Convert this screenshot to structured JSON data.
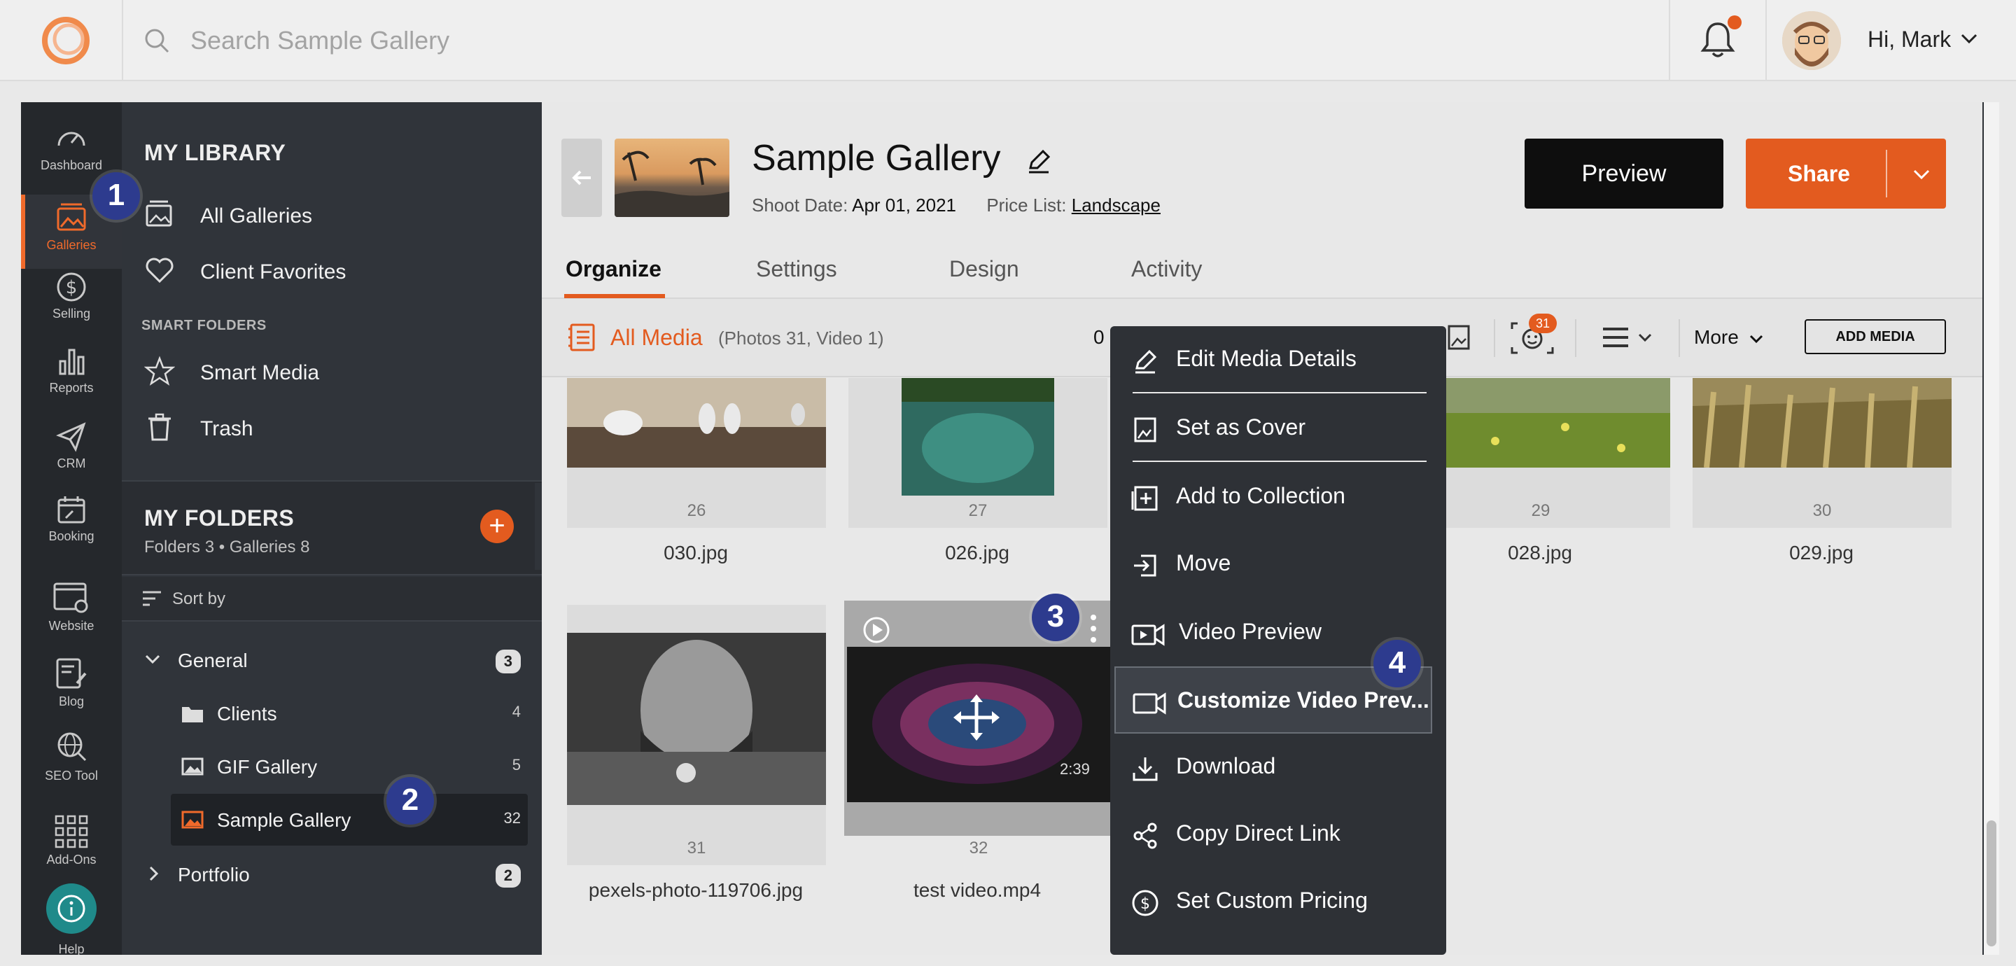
{
  "topbar": {
    "search_placeholder": "Search Sample Gallery",
    "greeting": "Hi, Mark"
  },
  "rail": {
    "items": [
      {
        "label": "Dashboard",
        "icon": "speedometer-icon"
      },
      {
        "label": "Galleries",
        "icon": "galleries-icon",
        "active": true
      },
      {
        "label": "Selling",
        "icon": "dollar-icon"
      },
      {
        "label": "Reports",
        "icon": "bar-chart-icon"
      },
      {
        "label": "CRM",
        "icon": "paper-plane-icon"
      },
      {
        "label": "Booking",
        "icon": "calendar-icon"
      },
      {
        "label": "Website",
        "icon": "website-icon"
      },
      {
        "label": "Blog",
        "icon": "blog-icon"
      },
      {
        "label": "SEO Tool",
        "icon": "globe-icon"
      },
      {
        "label": "Add-Ons",
        "icon": "grid-icon"
      },
      {
        "label": "Help",
        "icon": "help-icon"
      }
    ]
  },
  "library": {
    "title": "MY LIBRARY",
    "items": [
      {
        "label": "All Galleries",
        "icon": "galleries-icon"
      },
      {
        "label": "Client Favorites",
        "icon": "heart-icon"
      }
    ],
    "smart_folders_label": "SMART FOLDERS",
    "smart_items": [
      {
        "label": "Smart Media",
        "icon": "star-icon"
      },
      {
        "label": "Trash",
        "icon": "trash-icon"
      }
    ],
    "folders_title": "MY FOLDERS",
    "folders_subtitle": "Folders 3 • Galleries 8",
    "sort_label": "Sort by",
    "tree": [
      {
        "label": "General",
        "count": "3"
      },
      {
        "label": "Clients",
        "count": "4"
      },
      {
        "label": "GIF Gallery",
        "count": "5"
      },
      {
        "label": "Sample Gallery",
        "count": "32"
      },
      {
        "label": "Portfolio",
        "count": "2"
      }
    ]
  },
  "gallery": {
    "title": "Sample Gallery",
    "shoot_date_label": "Shoot Date:",
    "shoot_date": "Apr 01, 2021",
    "price_list_label": "Price List:",
    "price_list": "Landscape",
    "preview_label": "Preview",
    "share_label": "Share"
  },
  "tabs": [
    "Organize",
    "Settings",
    "Design",
    "Activity"
  ],
  "toolbar": {
    "all_media": "All Media",
    "media_count": "(Photos 31, Video 1)",
    "selected_prefix": "0",
    "face_count": "31",
    "more_label": "More",
    "add_media": "ADD MEDIA"
  },
  "media": [
    {
      "num": "26",
      "name": "030.jpg"
    },
    {
      "num": "27",
      "name": "026.jpg"
    },
    {
      "num": "29",
      "name": "028.jpg"
    },
    {
      "num": "30",
      "name": "029.jpg"
    },
    {
      "num": "31",
      "name": "pexels-photo-119706.jpg"
    },
    {
      "num": "32",
      "name": "test video.mp4",
      "duration": "2:39"
    }
  ],
  "context_menu": [
    {
      "label": "Edit Media Details",
      "icon": "pencil-icon"
    },
    {
      "label": "Set as Cover",
      "icon": "image-frame-icon"
    },
    {
      "label": "Add to Collection",
      "icon": "add-collection-icon"
    },
    {
      "label": "Move",
      "icon": "move-icon"
    },
    {
      "label": "Video Preview",
      "icon": "video-play-icon"
    },
    {
      "label": "Customize Video Prev...",
      "icon": "video-camera-icon"
    },
    {
      "label": "Download",
      "icon": "download-icon"
    },
    {
      "label": "Copy Direct Link",
      "icon": "share-link-icon"
    },
    {
      "label": "Set Custom Pricing",
      "icon": "dollar-circle-icon"
    }
  ],
  "steps": [
    "1",
    "2",
    "3",
    "4"
  ],
  "colors": {
    "accent": "#e35b1f",
    "sidebar": "#30343a",
    "step": "#2d3b8e"
  }
}
